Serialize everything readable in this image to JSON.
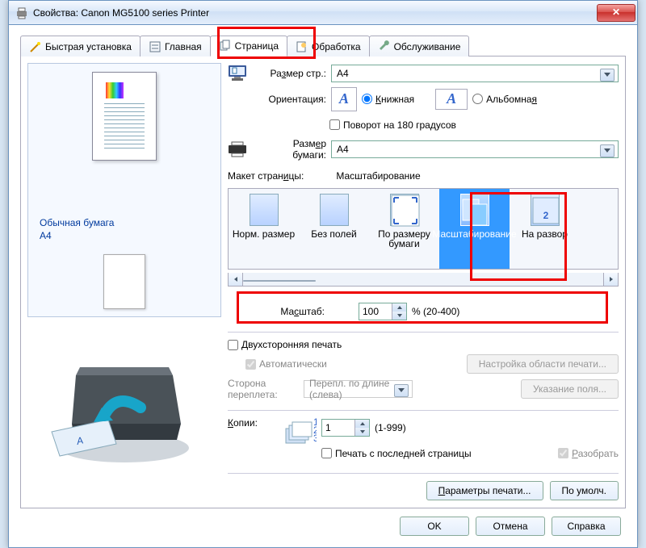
{
  "window": {
    "title": "Свойства: Canon MG5100 series Printer"
  },
  "tabs": {
    "quick": "Быстрая установка",
    "main": "Главная",
    "page": "Страница",
    "effects": "Обработка",
    "maint": "Обслуживание"
  },
  "preview": {
    "paper_type": "Обычная бумага",
    "paper_size": "A4"
  },
  "page_size": {
    "label": "Размер стр.:",
    "value": "A4"
  },
  "orientation": {
    "label": "Ориентация:",
    "portrait": "Книжная",
    "landscape": "Альбомная",
    "rotate180": "Поворот на 180 градусов"
  },
  "output_size": {
    "label": "Размер бумаги:",
    "value": "A4"
  },
  "layout": {
    "label": "Макет страницы:",
    "current": "Масштабирование",
    "items": [
      "Норм. размер",
      "Без полей",
      "По размеру бумаги",
      "Масштабирование",
      "На развор"
    ]
  },
  "scaling": {
    "label": "Масштаб:",
    "value": "100",
    "range": "% (20-400)"
  },
  "duplex": {
    "label": "Двухсторонняя печать",
    "auto": "Автоматически",
    "area_btn": "Настройка области печати...",
    "side_label": "Сторона переплета:",
    "side_value": "Перепл. по длине (слева)",
    "margin_btn": "Указание поля..."
  },
  "copies": {
    "label": "Копии:",
    "value": "1",
    "range": "(1-999)",
    "from_last": "Печать с последней страницы",
    "collate": "Разобрать"
  },
  "buttons": {
    "print_params": "Параметры печати...",
    "defaults": "По умолч.",
    "ok": "OK",
    "cancel": "Отмена",
    "help": "Справка"
  }
}
